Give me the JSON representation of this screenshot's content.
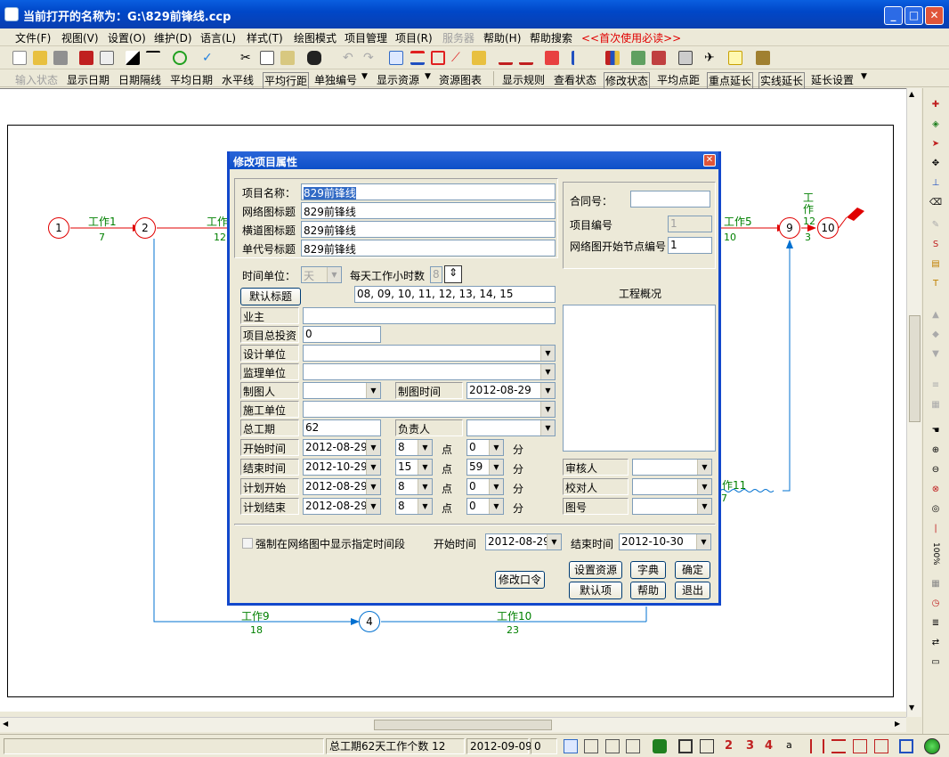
{
  "window": {
    "title": "当前打开的名称为：G:\\829前锋线.ccp",
    "min": "_",
    "max": "□",
    "close": "✕"
  },
  "menu": [
    "文件(F)",
    "视图(V)",
    "设置(O)",
    "维护(D)",
    "语言(L)",
    "样式(T)",
    "绘图模式",
    "项目管理",
    "项目(R)",
    "服务器",
    "帮助(H)",
    "帮助搜索",
    "<<首次使用必读>>"
  ],
  "toolbar2": [
    "输入状态",
    "显示日期",
    "日期隔线",
    "平均日期",
    "水平线",
    "平均行距",
    "单独编号",
    "显示资源",
    "资源图表",
    "显示规则",
    "查看状态",
    "修改状态",
    "平均点距",
    "重点延长",
    "实线延长",
    "延长设置"
  ],
  "network": {
    "nodes": [
      {
        "id": "1"
      },
      {
        "id": "2"
      },
      {
        "id": "4"
      },
      {
        "id": "9"
      },
      {
        "id": "10"
      }
    ],
    "works": [
      {
        "name": "工作1",
        "dur": "7"
      },
      {
        "name": "工作2",
        "dur": "12"
      },
      {
        "name": "工作5",
        "dur": "10"
      },
      {
        "name": "工作",
        "dur": "12"
      },
      {
        "name": "",
        "dur": "3"
      },
      {
        "name": "工作9",
        "dur": "18"
      },
      {
        "name": "工作10",
        "dur": "23"
      },
      {
        "name": "作11",
        "dur": "7"
      }
    ]
  },
  "dialog": {
    "title": "修改项目属性",
    "close": "✕",
    "labels": {
      "project_name": "项目名称：",
      "net_title": "网络图标题",
      "road_title": "横道图标题",
      "code_title": "单代号标题",
      "contract": "合同号：",
      "proj_no": "项目编号",
      "start_node": "网络图开始节点编号",
      "time_unit": "时间单位：",
      "hours_per_day": "每天工作小时数",
      "owner": "业主",
      "invest": "项目总投资",
      "design": "设计单位",
      "supervise": "监理单位",
      "drawer": "制图人",
      "draw_time": "制图时间",
      "builder": "施工单位",
      "total": "总工期",
      "leader": "负责人",
      "start": "开始时间",
      "end": "结束时间",
      "plan_start": "计划开始",
      "plan_end": "计划结束",
      "point": "点",
      "minute": "分",
      "overview": "工程概况",
      "reviewer": "审核人",
      "checker": "校对人",
      "drawing_no": "图号",
      "force": "强制在网络图中显示指定时间段",
      "f_start": "开始时间",
      "f_end": "结束时间"
    },
    "values": {
      "project_name": "829前锋线",
      "net_title": "829前锋线",
      "road_title": "829前锋线",
      "code_title": "829前锋线",
      "contract": "",
      "proj_no": "1",
      "start_node": "1",
      "time_unit": "天",
      "hours_per_day": "8",
      "default_title_list": "08, 09, 10, 11, 12, 13, 14, 15",
      "owner": "",
      "invest": "0",
      "draw_time": "2012-08-29",
      "total": "62",
      "start_date": "2012-08-29",
      "start_h": "8",
      "start_m": "0",
      "end_date": "2012-10-29",
      "end_h": "15",
      "end_m": "59",
      "ps_date": "2012-08-29",
      "ps_h": "8",
      "ps_m": "0",
      "pe_date": "2012-08-29",
      "pe_h": "8",
      "pe_m": "0",
      "f_start": "2012-08-29",
      "f_end": "2012-10-30"
    },
    "buttons": {
      "default_title": "默认标题",
      "change_pwd": "修改口令",
      "set_res": "设置资源",
      "dict": "字典",
      "ok": "确定",
      "default": "默认项",
      "help": "帮助",
      "exit": "退出"
    }
  },
  "status": {
    "summary": "总工期62天工作个数 12",
    "date": "2012-09-09",
    "num": "0"
  },
  "zoom": "100%"
}
